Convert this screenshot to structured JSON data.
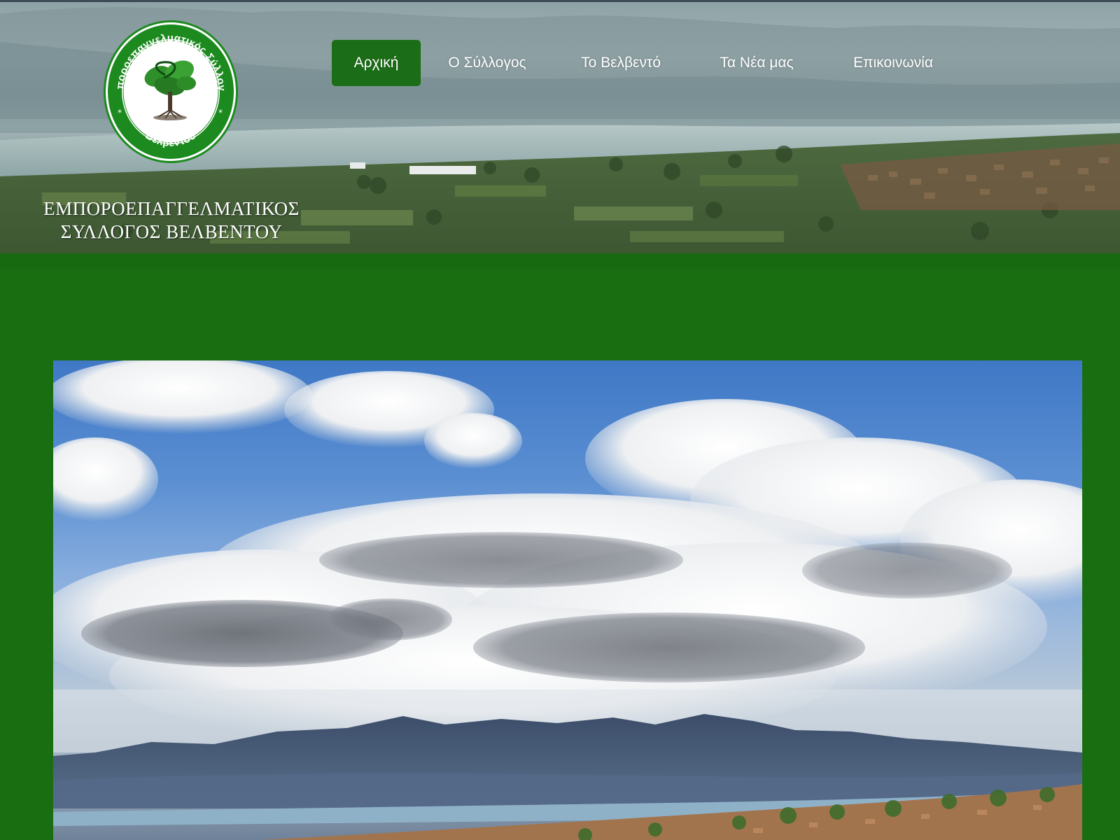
{
  "site": {
    "seal_text_top": "Εμποροεπαγγελματικός Σύλλογος",
    "seal_text_bottom": "Βελβεντού",
    "org_name_line1": "ΕΜΠΟΡΟΕΠΑΓΓΕΛΜΑΤΙΚΟΣ",
    "org_name_line2": "ΣΥΛΛΟΓΟΣ ΒΕΛΒΕΝΤΟΥ"
  },
  "nav": {
    "items": [
      {
        "label": "Αρχική",
        "active": true
      },
      {
        "label": "Ο Σύλλογος",
        "active": false
      },
      {
        "label": "Το Βελβεντό",
        "active": false
      },
      {
        "label": "Τα Νέα μας",
        "active": false
      },
      {
        "label": "Επικοινωνία",
        "active": false
      }
    ]
  },
  "colors": {
    "brand_green": "#1a6e12",
    "nav_active_bg": "#1b6e17",
    "nav_text": "#ffffff"
  },
  "icons": {
    "logo": "tree-seal-logo"
  }
}
